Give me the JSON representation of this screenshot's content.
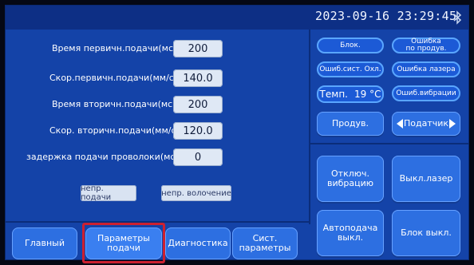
{
  "datetime": "2023-09-16 23:29:45",
  "params": [
    {
      "label": "Время первичн.подачи(мс)",
      "value": "200"
    },
    {
      "label": "Скор.первичн.подачи(мм/с)",
      "value": "140.0"
    },
    {
      "label": "Время вторичн.подачи(мс)",
      "value": "200"
    },
    {
      "label": "Скор. вторичн.подачи(мм/с)",
      "value": "120.0"
    },
    {
      "label": "задержка подачи проволоки(мс)",
      "value": "0"
    }
  ],
  "buttons": {
    "continuous_feed": "непр. подачи",
    "continuous_on": "непр. волочение"
  },
  "status": {
    "lock": "Блок.",
    "feed_error_line1": "Ошибка",
    "feed_error_line2": "по продув.",
    "cooling_error": "Ошиб.сист. Охл.",
    "laser_error": "Ошибка лазера",
    "temp_label": "Темп.",
    "temp_value": "19 °C",
    "vibration_error": "Ошиб.вибрации"
  },
  "controls": {
    "purge": "Продув.",
    "feeder": "Податчик",
    "vibration_off_line1": "Отключ.",
    "vibration_off_line2": "вибрацию",
    "laser_off": "Выкл.лазер",
    "autofeed_line1": "Автоподача",
    "autofeed_line2": "выкл.",
    "lock_off": "Блок выкл."
  },
  "tabs": {
    "main": "Главный",
    "feed_params_line1": "Параметры",
    "feed_params_line2": "подачи",
    "diagnostics": "Диагностика",
    "sys_params_line1": "Сист.",
    "sys_params_line2": "параметры"
  },
  "colors": {
    "panel": "#1443a8",
    "button": "#2d6fe1",
    "highlight": "#cc2030"
  },
  "icons": {
    "bluetooth": "bluetooth-icon",
    "left": "arrow-left-icon",
    "right": "arrow-right-icon"
  }
}
